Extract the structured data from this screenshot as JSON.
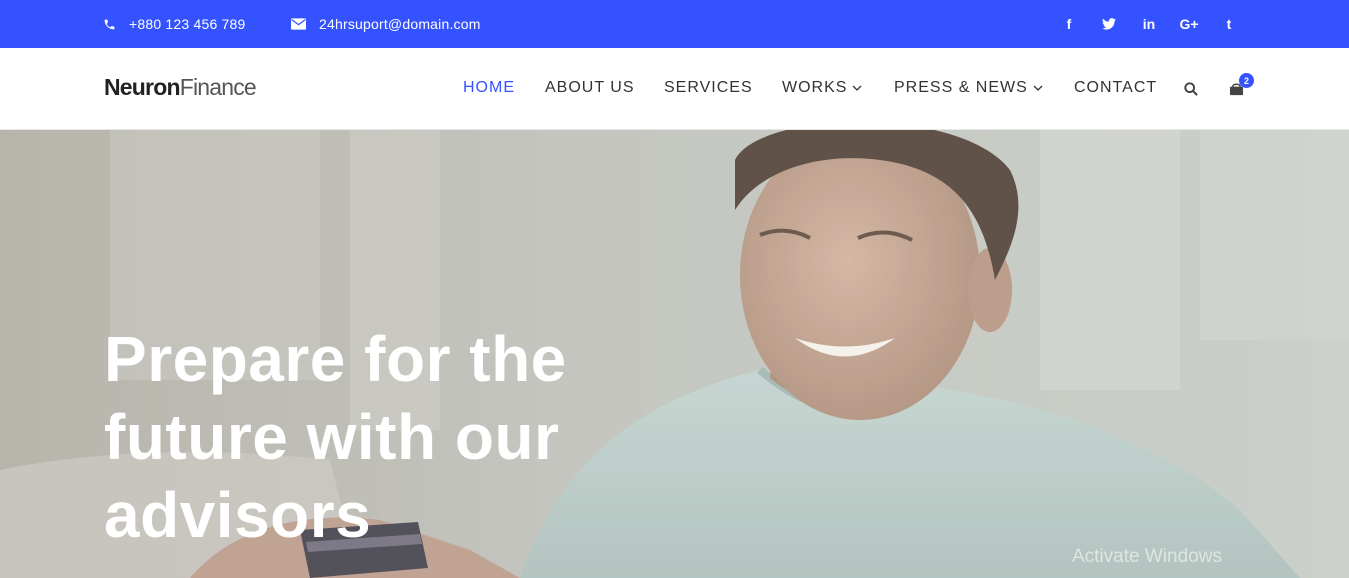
{
  "topbar": {
    "phone": "+880 123 456 789",
    "email": "24hrsuport@domain.com",
    "socials": [
      {
        "icon": "facebook-icon",
        "glyph": "f"
      },
      {
        "icon": "twitter-icon",
        "glyph": "t"
      },
      {
        "icon": "linkedin-icon",
        "glyph": "in"
      },
      {
        "icon": "google-plus-icon",
        "glyph": "G+"
      },
      {
        "icon": "tumblr-icon",
        "glyph": "t"
      }
    ],
    "background": "#3452ff"
  },
  "header": {
    "logo_strong": "Neuron",
    "logo_light": "Finance",
    "nav": {
      "home": "HOME",
      "about": "ABOUT US",
      "services": "SERVICES",
      "works": "WORKS",
      "press": "PRESS & NEWS",
      "contact": "CONTACT"
    },
    "cart_count": "2",
    "accent": "#3452ff"
  },
  "hero": {
    "heading_line1": "Prepare for the",
    "heading_line2": "future with our",
    "heading_line3": "advisors"
  },
  "watermark": "Activate Windows"
}
